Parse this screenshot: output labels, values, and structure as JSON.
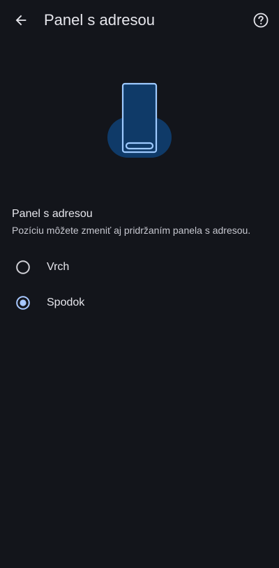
{
  "header": {
    "title": "Panel s adresou",
    "back_icon": "arrow-back-icon",
    "help_icon": "help-circle-icon"
  },
  "illustration": {
    "icon": "phone-bottom-bar-illustration",
    "accent_color": "#9ecaff",
    "fill_color": "#0f3a68"
  },
  "section": {
    "title": "Panel s adresou",
    "subtitle": "Pozíciu môžete zmeniť aj pridržaním panela s adresou."
  },
  "options": [
    {
      "label": "Vrch",
      "selected": false
    },
    {
      "label": "Spodok",
      "selected": true
    }
  ],
  "colors": {
    "background": "#13151b",
    "text": "#e6e6ec",
    "radio_selected": "#a8c8ff",
    "radio_unselected": "#d0d0d6"
  }
}
